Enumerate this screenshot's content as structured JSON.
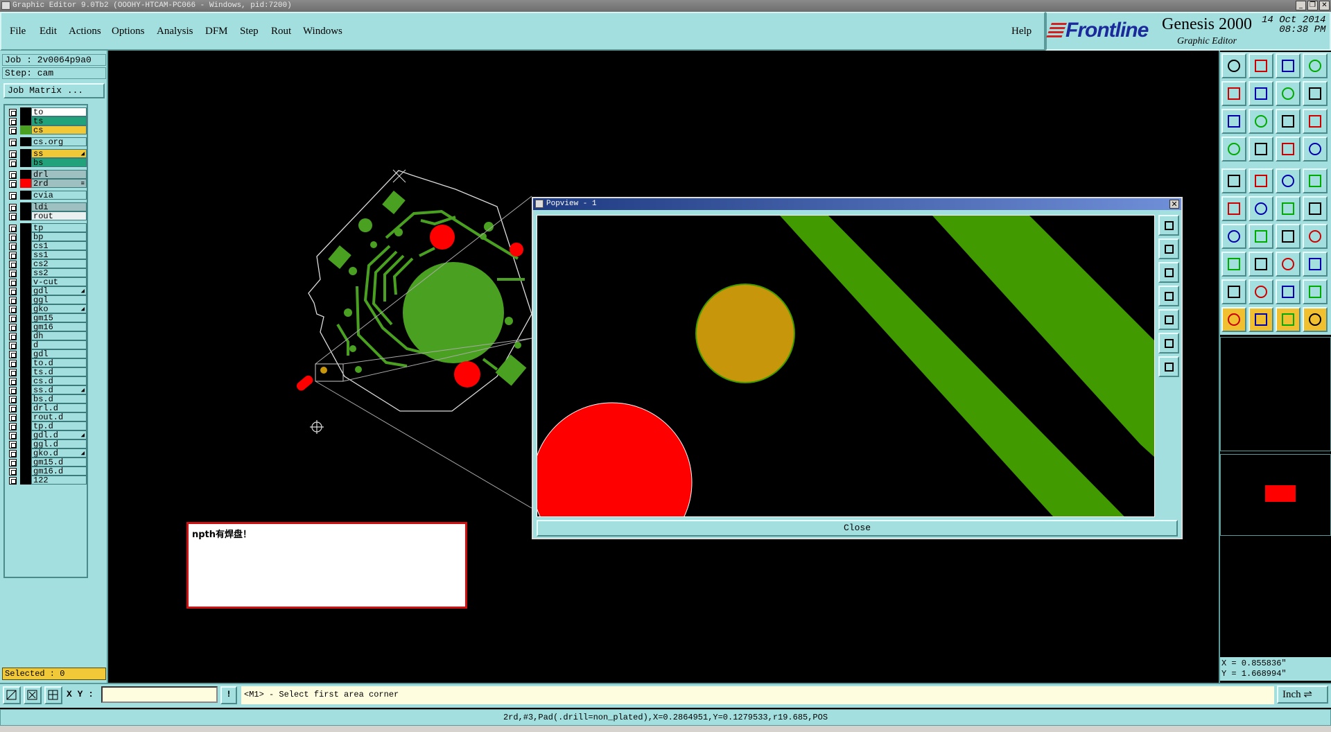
{
  "window": {
    "title": "Graphic Editor 9.0Tb2 (OOOHY-HTCAM-PC066 - Windows, pid:7200)"
  },
  "menu": [
    {
      "label": "File"
    },
    {
      "label": "Edit"
    },
    {
      "label": "Actions"
    },
    {
      "label": "Options"
    },
    {
      "label": "Analysis"
    },
    {
      "label": "DFM"
    },
    {
      "label": "Step"
    },
    {
      "label": "Rout"
    },
    {
      "label": "Windows"
    }
  ],
  "help_label": "Help",
  "brand": {
    "logo": "Frontline",
    "product": "Genesis 2000",
    "subtitle": "Graphic Editor",
    "date": "14 Oct 2014",
    "time": "08:38 PM"
  },
  "job": {
    "job_line": "Job : 2v0064p9a0",
    "step_line": "Step: cam",
    "matrix_button": "Job Matrix ..."
  },
  "layers": [
    {
      "name": "to",
      "color": "#ffffff",
      "swatch": ""
    },
    {
      "name": "ts",
      "color": "#22a27a",
      "swatch": ""
    },
    {
      "name": "cs",
      "color": "#f0c838",
      "swatch": "#4aa020"
    },
    {
      "name": "cs.org",
      "color": "#a4dfdf",
      "swatch": ""
    },
    {
      "name": "ss",
      "color": "#f0c838",
      "swatch": "",
      "mark": "◢"
    },
    {
      "name": "bs",
      "color": "#22a27a",
      "swatch": ""
    },
    {
      "name": "drl",
      "color": "#9fc0c0",
      "swatch": ""
    },
    {
      "name": "2rd",
      "color": "#9fc0c0",
      "swatch": "#ff0000",
      "mark": "≡"
    },
    {
      "name": "cvia",
      "color": "#a4dfdf",
      "swatch": ""
    },
    {
      "name": "ldi",
      "color": "#9fc0c0",
      "swatch": ""
    },
    {
      "name": "rout",
      "color": "#e8f0f0",
      "swatch": ""
    },
    {
      "name": "tp",
      "color": "#a4dfdf",
      "swatch": ""
    },
    {
      "name": "bp",
      "color": "#a4dfdf",
      "swatch": ""
    },
    {
      "name": "cs1",
      "color": "#a4dfdf",
      "swatch": ""
    },
    {
      "name": "ss1",
      "color": "#a4dfdf",
      "swatch": ""
    },
    {
      "name": "cs2",
      "color": "#a4dfdf",
      "swatch": ""
    },
    {
      "name": "ss2",
      "color": "#a4dfdf",
      "swatch": ""
    },
    {
      "name": "v-cut",
      "color": "#a4dfdf",
      "swatch": ""
    },
    {
      "name": "gdl",
      "color": "#a4dfdf",
      "swatch": "",
      "mark": "◢"
    },
    {
      "name": "ggl",
      "color": "#a4dfdf",
      "swatch": ""
    },
    {
      "name": "gko",
      "color": "#a4dfdf",
      "swatch": "",
      "mark": "◢"
    },
    {
      "name": "gm15",
      "color": "#a4dfdf",
      "swatch": ""
    },
    {
      "name": "gm16",
      "color": "#a4dfdf",
      "swatch": ""
    },
    {
      "name": "dh",
      "color": "#a4dfdf",
      "swatch": ""
    },
    {
      "name": "d",
      "color": "#a4dfdf",
      "swatch": ""
    },
    {
      "name": "gdl",
      "color": "#a4dfdf",
      "swatch": ""
    },
    {
      "name": "to.d",
      "color": "#a4dfdf",
      "swatch": ""
    },
    {
      "name": "ts.d",
      "color": "#a4dfdf",
      "swatch": ""
    },
    {
      "name": "cs.d",
      "color": "#a4dfdf",
      "swatch": ""
    },
    {
      "name": "ss.d",
      "color": "#a4dfdf",
      "swatch": "",
      "mark": "◢"
    },
    {
      "name": "bs.d",
      "color": "#a4dfdf",
      "swatch": ""
    },
    {
      "name": "drl.d",
      "color": "#a4dfdf",
      "swatch": ""
    },
    {
      "name": "rout.d",
      "color": "#a4dfdf",
      "swatch": ""
    },
    {
      "name": "tp.d",
      "color": "#a4dfdf",
      "swatch": ""
    },
    {
      "name": "gdl.d",
      "color": "#a4dfdf",
      "swatch": "",
      "mark": "◢"
    },
    {
      "name": "ggl.d",
      "color": "#a4dfdf",
      "swatch": ""
    },
    {
      "name": "gko.d",
      "color": "#a4dfdf",
      "swatch": "",
      "mark": "◢"
    },
    {
      "name": "gm15.d",
      "color": "#a4dfdf",
      "swatch": ""
    },
    {
      "name": "gm16.d",
      "color": "#a4dfdf",
      "swatch": ""
    },
    {
      "name": "122",
      "color": "#a4dfdf",
      "swatch": ""
    }
  ],
  "selected_label": "Selected : 0",
  "popview": {
    "title": "Popview - 1",
    "close_button": "Close",
    "close_glyph": "✕"
  },
  "message_box": {
    "text": "npth有焊盘！"
  },
  "coords": {
    "x": "X = 0.855836\"",
    "y": "Y = 1.668994\""
  },
  "bottom": {
    "xy_label": "X Y :",
    "xy_value": "",
    "excl": "!",
    "prompt": "<M1> - Select first area corner",
    "unit": "Inch ⇌"
  },
  "status_line": "2rd,#3,Pad(.drill=non_plated),X=0.2864951,Y=0.1279533,r19.685,POS",
  "colors": {
    "panel": "#a4dfdf",
    "copper": "#4aa020",
    "drill_red": "#ff0000",
    "pad_gold": "#c8960a"
  }
}
